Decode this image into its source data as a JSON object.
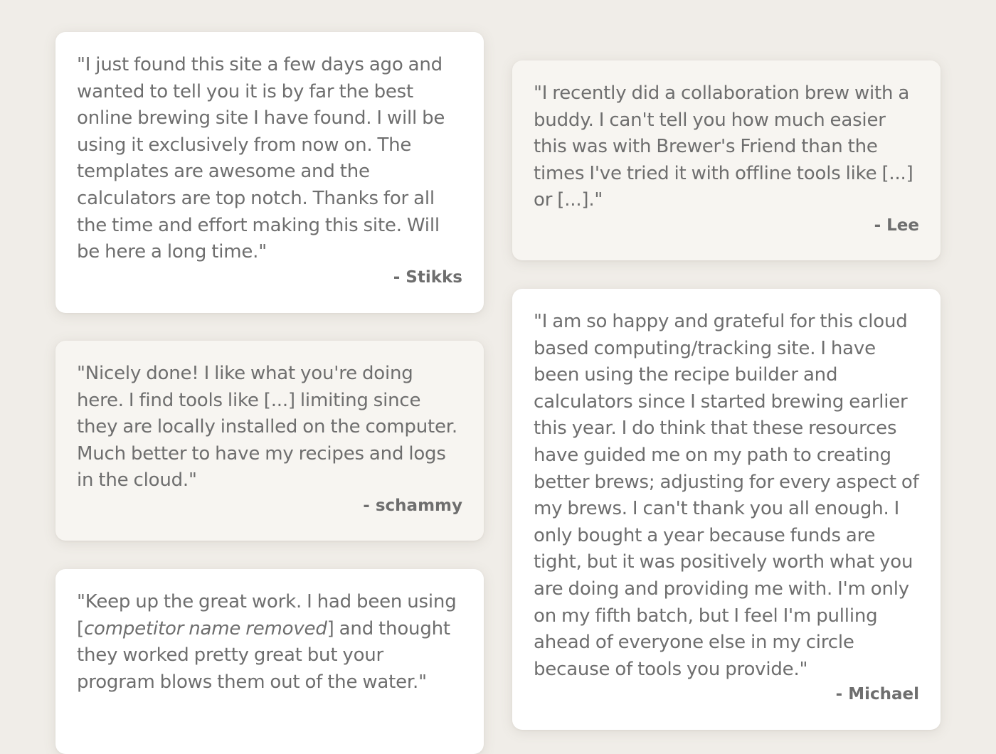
{
  "testimonials": [
    {
      "quote": "\"I just found this site a few days ago and wanted to tell you it is by far the best online brewing site I have found. I will be using it exclusively from now on. The templates are awesome and the calculators are top notch. Thanks for all the time and effort making this site. Will be here a long time.\"",
      "author": "- Stikks"
    },
    {
      "quote": "\"I recently did a collaboration brew with a buddy. I can't tell you how much easier this was with Brewer's Friend than the times I've tried it with offline tools like [...] or [...].\"",
      "author": "- Lee"
    },
    {
      "quote": "\"Nicely done! I like what you're doing here. I find tools like [...] limiting since they are locally installed on the computer. Much better to have my recipes and logs in the cloud.\"",
      "author": "- schammy"
    },
    {
      "quote": "\"I am so happy and grateful for this cloud based computing/tracking site. I have been using the recipe builder and calculators since I started brewing earlier this year. I do think that these resources have guided me on my path to creating better brews; adjusting for every aspect of my brews. I can't thank you all enough. I only bought a year because funds are tight, but it was positively worth what you are doing and providing me with. I'm only on my fifth batch, but I feel I'm pulling ahead of everyone else in my circle because of tools you provide.\"",
      "author": "- Michael"
    },
    {
      "quote_before": "\"Keep up the great work. I had been using [",
      "quote_italic": "competitor name removed",
      "quote_after": "] and thought they worked pretty great but your program blows them out of the water.\""
    }
  ],
  "colors": {
    "page_background": "#f0ede8",
    "card_white": "#ffffff",
    "card_cream": "#f7f5f1",
    "text": "#6e6e6e"
  }
}
